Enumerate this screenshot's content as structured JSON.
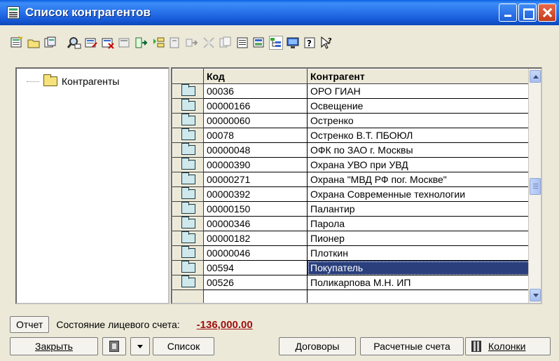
{
  "window": {
    "title": "Список контрагентов",
    "title_bar_color": "#1f63dd"
  },
  "toolbar": {
    "icons": [
      "new-item-icon",
      "new-folder-icon",
      "copy-icon",
      "find-icon",
      "edit-icon",
      "delete-icon",
      "mark-delete-icon",
      "move-icon",
      "hierarchy-icon",
      "print-icon",
      "next-icon",
      "filter-icon",
      "copy-doc-icon",
      "properties-icon",
      "journal-icon",
      "tree-view-icon",
      "display-icon",
      "help-icon",
      "whats-this-icon"
    ]
  },
  "tree": {
    "root_label": "Контрагенты"
  },
  "grid": {
    "columns": [
      "Код",
      "Контрагент"
    ],
    "rows": [
      {
        "code": "00036",
        "name": "ОРО ГИАН"
      },
      {
        "code": "00000166",
        "name": "Освещение"
      },
      {
        "code": "00000060",
        "name": "Остренко"
      },
      {
        "code": "00078",
        "name": "Остренко В.Т. ПБОЮЛ"
      },
      {
        "code": "00000048",
        "name": "ОФК по ЗАО г. Москвы"
      },
      {
        "code": "00000390",
        "name": "Охрана  УВО при УВД"
      },
      {
        "code": "00000271",
        "name": "Охрана \"МВД РФ пог. Москве\""
      },
      {
        "code": "00000392",
        "name": "Охрана Современные технологии"
      },
      {
        "code": "00000150",
        "name": "Палантир"
      },
      {
        "code": "00000346",
        "name": "Парола"
      },
      {
        "code": "00000182",
        "name": "Пионер"
      },
      {
        "code": "00000046",
        "name": "Плоткин"
      },
      {
        "code": "00594",
        "name": "Покупатель",
        "selected": true
      },
      {
        "code": "00526",
        "name": "Поликарпова М.Н. ИП"
      },
      {
        "code": "",
        "name": ""
      }
    ],
    "selected_row_color": "#2a3f7c"
  },
  "status": {
    "report_button": "Отчет",
    "account_label": "Состояние лицевого счета:",
    "account_value": "-136,000.00",
    "value_color": "#a01010"
  },
  "buttons": {
    "close": "Закрыть",
    "list": "Список",
    "contracts": "Договоры",
    "accounts": "Расчетные счета",
    "columns": "Колонки"
  }
}
